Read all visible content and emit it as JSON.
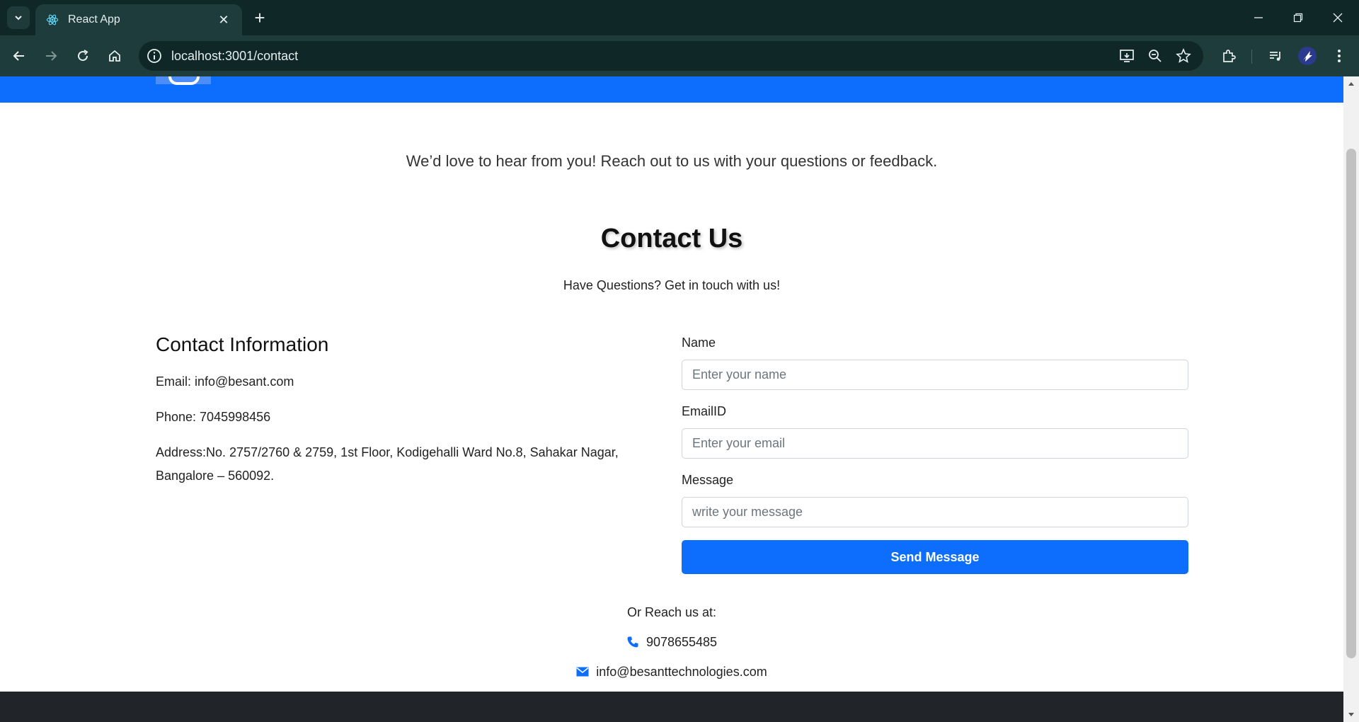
{
  "browser": {
    "tab_title": "React App",
    "url": "localhost:3001/contact"
  },
  "page": {
    "intro": "We’d love to hear from you! Reach out to us with your questions or feedback.",
    "title": "Contact Us",
    "subtitle": "Have Questions? Get in touch with us!"
  },
  "info": {
    "heading": "Contact Information",
    "email": "Email: info@besant.com",
    "phone": "Phone: 7045998456",
    "address": "Address:No. 2757/2760 & 2759, 1st Floor, Kodigehalli Ward No.8, Sahakar Nagar, Bangalore – 560092."
  },
  "form": {
    "name_label": "Name",
    "name_placeholder": "Enter your name",
    "email_label": "EmailID",
    "email_placeholder": "Enter your email",
    "message_label": "Message",
    "message_placeholder": "write your message",
    "submit_label": "Send Message"
  },
  "reach": {
    "label": "Or Reach us at:",
    "phone": "9078655485",
    "email": "info@besanttechnologies.com"
  },
  "icons": {
    "tab_favicon": "react-icon",
    "phone": "phone-icon",
    "email": "envelope-icon"
  },
  "colors": {
    "primary": "#0d6efd",
    "chrome_dark": "#0f2727",
    "chrome_toolbar": "#1e3c3c",
    "footer": "#212529"
  }
}
